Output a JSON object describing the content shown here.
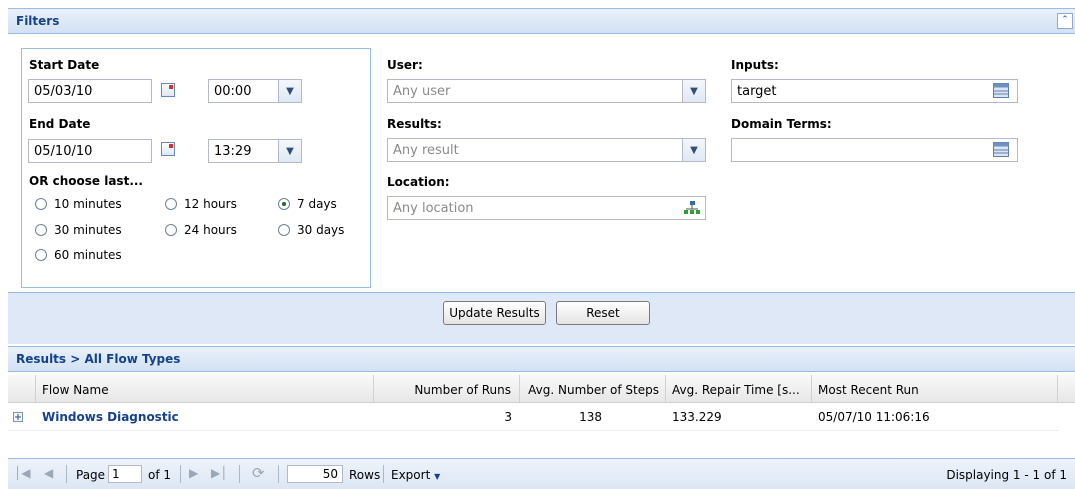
{
  "filters": {
    "title": "Filters",
    "start_date_label": "Start Date",
    "start_date": "05/03/10",
    "start_time": "00:00",
    "end_date_label": "End Date",
    "end_date": "05/10/10",
    "end_time": "13:29",
    "choose_last_label": "OR choose last...",
    "ranges": [
      {
        "label": "10 minutes",
        "selected": false
      },
      {
        "label": "12 hours",
        "selected": false
      },
      {
        "label": "7 days",
        "selected": true
      },
      {
        "label": "30 minutes",
        "selected": false
      },
      {
        "label": "24 hours",
        "selected": false
      },
      {
        "label": "30 days",
        "selected": false
      },
      {
        "label": "60 minutes",
        "selected": false
      }
    ],
    "user_label": "User:",
    "user_placeholder": "Any user",
    "results_label": "Results:",
    "results_placeholder": "Any result",
    "location_label": "Location:",
    "location_placeholder": "Any location",
    "inputs_label": "Inputs:",
    "inputs_value": "target",
    "domain_terms_label": "Domain Terms:",
    "domain_terms_value": ""
  },
  "actions": {
    "update_label": "Update Results",
    "reset_label": "Reset"
  },
  "results": {
    "title": "Results > All Flow Types",
    "columns": [
      "Flow Name",
      "Number of Runs",
      "Avg. Number of Steps",
      "Avg. Repair Time [s...",
      "Most Recent Run"
    ],
    "rows": [
      {
        "flow_name": "Windows Diagnostic",
        "runs": "3",
        "steps": "138",
        "repair_time": "133.229",
        "recent_run": "05/07/10 11:06:16"
      }
    ]
  },
  "pager": {
    "page_label": "Page",
    "page_value": "1",
    "of_label": "of 1",
    "rows_value": "50",
    "rows_label": "Rows",
    "export_label": "Export",
    "displaying": "Displaying 1 - 1 of 1"
  },
  "icons": {
    "collapse": "double-chevron-up-icon",
    "calendar": "calendar-icon",
    "dropdown": "chevron-down-icon",
    "table_picker": "table-picker-icon",
    "location_picker": "tree-icon",
    "expand_row": "plus-box-icon"
  }
}
